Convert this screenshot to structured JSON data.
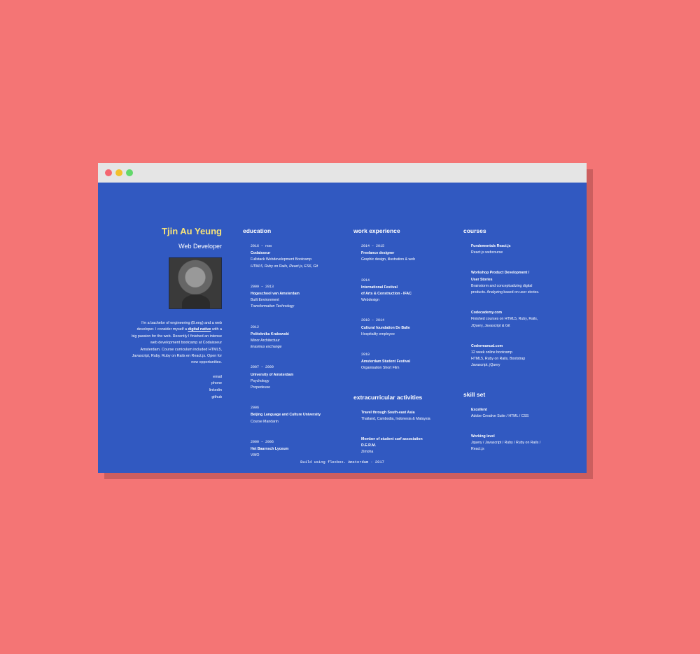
{
  "profile": {
    "name": "Tjin Au Yeung",
    "role": "Web Developer",
    "bio_before": "I'm a bachelor of engineering (B.eng) and a web developer. I consider myself a",
    "bio_link": "digital native",
    "bio_after": "with a big passion for the web. Recently I finished an intense web development bootcamp at Codaisseur Amsterdam. Course curriculum included HTML5, Javascript, Ruby, Ruby on Rails en React.js. Open for new opportunities.",
    "contact": [
      "email",
      "phone",
      "linkedin",
      "github"
    ]
  },
  "education": {
    "title": "education",
    "entries": [
      {
        "date": "2016 – now",
        "lines": [
          "Codaisseur",
          "Fullstack Webdevelopment Bootcamp"
        ],
        "extra": "HTML5, Ruby on Rails, React.js, ES6, Git"
      },
      {
        "date": "2009 – 2013",
        "lines": [
          "Hogeschool van Amsterdam",
          "Built Environment"
        ],
        "extra": "Transformation Technology"
      },
      {
        "date": "2012",
        "lines": [
          "Politeknika Krakowski",
          "Minor Architectuur"
        ],
        "extra": "Erasmus exchange"
      },
      {
        "date": "2007 – 2009",
        "lines": [
          "University of Amsterdam",
          "Psychology"
        ],
        "extra": "Propedeuse"
      },
      {
        "date": "2006",
        "lines": [
          "Beijing Language and Culture University",
          "Course Mandarin"
        ],
        "extra": ""
      },
      {
        "date": "2000 – 2006",
        "lines": [
          "Het Baarnsch Lyceum",
          "VWO"
        ],
        "extra": ""
      }
    ]
  },
  "work": {
    "title": "work experience",
    "entries": [
      {
        "date": "2014 – 2015",
        "lines": [
          "Freelance designer",
          "Graphic design, illustration & web"
        ]
      },
      {
        "date": "2014",
        "lines": [
          "International Festival",
          "of Arts & Construction - IFAC",
          "Webdesign"
        ]
      },
      {
        "date": "2010 – 2014",
        "lines": [
          "Cultural foundation De Balie",
          "Hospitality employee"
        ]
      },
      {
        "date": "2010",
        "lines": [
          "Amsterdam Student Festival",
          "Organisation Short Film"
        ]
      }
    ]
  },
  "extracurricular": {
    "title": "extracurricular activities",
    "entries": [
      {
        "lines": [
          "Travel through South-east Asia",
          "Thailand, Cambodia, Indonesia & Malaysia"
        ]
      },
      {
        "lines": [
          "Member of student surf association",
          "D.E.R.M.",
          "Zimoha"
        ]
      }
    ]
  },
  "courses": {
    "title": "courses",
    "entries": [
      {
        "lines": [
          "Fundementals React.js",
          "React.js webcourse"
        ]
      },
      {
        "lines": [
          "Workshop Product Development /",
          "User Stories",
          "Brainstorm and conceptualizing digital",
          "products. Analyzing based on user stories."
        ]
      },
      {
        "lines": [
          "Codecademy.com",
          "Finished courses on HTML5, Ruby, Rails,",
          "JQuery, Javascript & Git"
        ]
      },
      {
        "lines": [
          "Codermanual.com",
          "12 week online bootcamp",
          "HTML5, Ruby on Rails, Bootstrap",
          "Javascript, jQuery"
        ]
      }
    ]
  },
  "skills": {
    "title": "skill set",
    "entries": [
      {
        "lines": [
          "Excellent",
          "Adobe Creative Suite / HTML / CSS"
        ]
      },
      {
        "lines": [
          "Working level",
          "Jquery / Javascript / Ruby / Ruby on Rails /",
          "React.js"
        ]
      }
    ]
  },
  "footer": "Build using flexbox. Amsterdam - 2017",
  "colors": {
    "background": "#f47575",
    "page": "#3159c1",
    "name": "#f5e27a"
  }
}
